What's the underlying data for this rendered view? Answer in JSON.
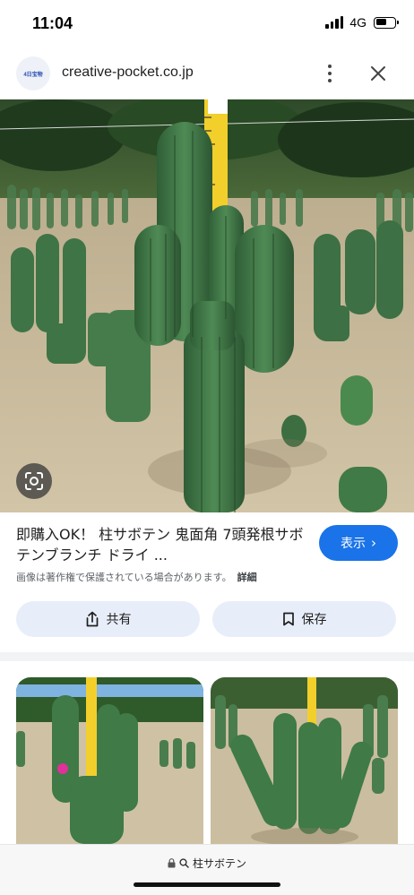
{
  "status_bar": {
    "time": "11:04",
    "network": "4G",
    "battery_level": 0.6
  },
  "header": {
    "favicon_text": "4日宝物",
    "domain": "creative-pocket.co.jp",
    "icons": [
      "more-vert-icon",
      "close-icon"
    ]
  },
  "result": {
    "title": "即購入OK！ 柱サボテン 鬼面角 7頭発根サボテンブランチ ドライ ...",
    "view_label": "表示",
    "copyright_note": "画像は著作権で保護されている場合があります。",
    "details_label": "詳細"
  },
  "actions": {
    "share_label": "共有",
    "save_label": "保存"
  },
  "bottom_bar": {
    "query": "柱サボテン",
    "icons": [
      "lock-icon",
      "search-icon"
    ]
  },
  "colors": {
    "accent": "#1a73e8",
    "chip_bg": "#e8eef9",
    "cactus": "#3f7a47",
    "sand": "#cbbd9f"
  }
}
